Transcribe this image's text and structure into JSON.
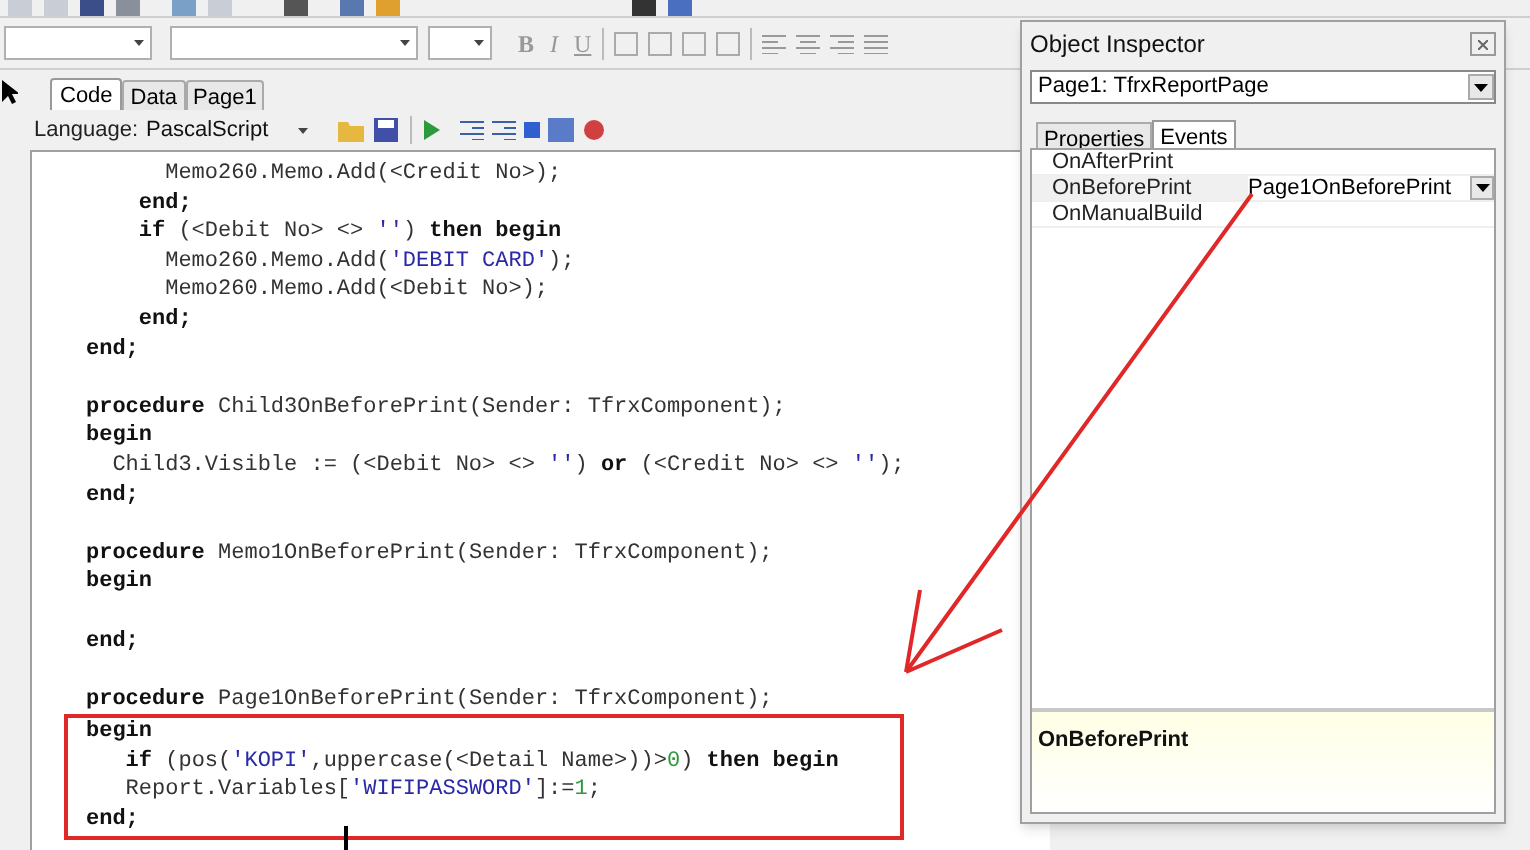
{
  "format_toolbar": {
    "buttons": [
      {
        "label": "B",
        "kind": "bold"
      },
      {
        "label": "I",
        "kind": "italic"
      },
      {
        "label": "U",
        "kind": "underline"
      }
    ]
  },
  "editor_tabs": [
    {
      "label": "Code",
      "selected": true
    },
    {
      "label": "Data",
      "selected": false
    },
    {
      "label": "Page1",
      "selected": false
    }
  ],
  "language": {
    "label": "Language:",
    "value": "PascalScript"
  },
  "code_lines": [
    {
      "kind": "code",
      "tokens": [
        {
          "kind": "plain",
          "text": "      Memo260.Memo.Add(<Credit No>);"
        }
      ]
    },
    {
      "kind": "code",
      "tokens": [
        {
          "kind": "keyword",
          "text": "    end;"
        }
      ]
    },
    {
      "kind": "code",
      "tokens": [
        {
          "kind": "keyword",
          "text": "    if"
        },
        {
          "kind": "plain",
          "text": " (<Debit No> <> "
        },
        {
          "kind": "string",
          "text": "''"
        },
        {
          "kind": "plain",
          "text": ") "
        },
        {
          "kind": "keyword",
          "text": "then begin"
        }
      ]
    },
    {
      "kind": "code",
      "tokens": [
        {
          "kind": "plain",
          "text": "      Memo260.Memo.Add("
        },
        {
          "kind": "string",
          "text": "'DEBIT CARD'"
        },
        {
          "kind": "plain",
          "text": ");"
        }
      ]
    },
    {
      "kind": "code",
      "tokens": [
        {
          "kind": "plain",
          "text": "      Memo260.Memo.Add(<Debit No>);"
        }
      ]
    },
    {
      "kind": "code",
      "tokens": [
        {
          "kind": "keyword",
          "text": "    end;"
        }
      ]
    },
    {
      "kind": "code",
      "tokens": [
        {
          "kind": "keyword",
          "text": "end;"
        }
      ]
    },
    {
      "kind": "blank"
    },
    {
      "kind": "code",
      "tokens": [
        {
          "kind": "keyword",
          "text": "procedure"
        },
        {
          "kind": "plain",
          "text": " Child3OnBeforePrint(Sender: TfrxComponent);"
        }
      ]
    },
    {
      "kind": "code",
      "tokens": [
        {
          "kind": "keyword",
          "text": "begin"
        }
      ]
    },
    {
      "kind": "code",
      "tokens": [
        {
          "kind": "plain",
          "text": "  Child3.Visible := (<Debit No> <> "
        },
        {
          "kind": "string",
          "text": "''"
        },
        {
          "kind": "plain",
          "text": ") "
        },
        {
          "kind": "keyword",
          "text": "or"
        },
        {
          "kind": "plain",
          "text": " (<Credit No> <> "
        },
        {
          "kind": "string",
          "text": "''"
        },
        {
          "kind": "plain",
          "text": ");"
        }
      ]
    },
    {
      "kind": "code",
      "tokens": [
        {
          "kind": "keyword",
          "text": "end;"
        }
      ]
    },
    {
      "kind": "blank"
    },
    {
      "kind": "code",
      "tokens": [
        {
          "kind": "keyword",
          "text": "procedure"
        },
        {
          "kind": "plain",
          "text": " Memo1OnBeforePrint(Sender: TfrxComponent);"
        }
      ]
    },
    {
      "kind": "code",
      "tokens": [
        {
          "kind": "keyword",
          "text": "begin"
        }
      ]
    },
    {
      "kind": "blank"
    },
    {
      "kind": "code",
      "tokens": [
        {
          "kind": "keyword",
          "text": "end;"
        }
      ]
    },
    {
      "kind": "blank"
    },
    {
      "kind": "code",
      "tokens": [
        {
          "kind": "keyword",
          "text": "procedure"
        },
        {
          "kind": "plain",
          "text": " Page1OnBeforePrint(Sender: TfrxComponent);"
        }
      ]
    },
    {
      "kind": "code",
      "highlighted": true,
      "tokens": [
        {
          "kind": "keyword",
          "text": "begin"
        }
      ]
    },
    {
      "kind": "code",
      "highlighted": true,
      "tokens": [
        {
          "kind": "keyword",
          "text": "   if"
        },
        {
          "kind": "plain",
          "text": " (pos("
        },
        {
          "kind": "string",
          "text": "'KOPI'"
        },
        {
          "kind": "plain",
          "text": ",uppercase(<Detail Name>))>"
        },
        {
          "kind": "number",
          "text": "0"
        },
        {
          "kind": "plain",
          "text": ") "
        },
        {
          "kind": "keyword",
          "text": "then begin"
        }
      ]
    },
    {
      "kind": "code",
      "highlighted": true,
      "tokens": [
        {
          "kind": "plain",
          "text": "   Report.Variables["
        },
        {
          "kind": "string",
          "text": "'WIFIPASSWORD'"
        },
        {
          "kind": "plain",
          "text": "]:="
        },
        {
          "kind": "number",
          "text": "1"
        },
        {
          "kind": "plain",
          "text": ";"
        }
      ]
    },
    {
      "kind": "code",
      "highlighted": true,
      "tokens": [
        {
          "kind": "keyword",
          "text": "end;"
        }
      ]
    }
  ],
  "object_inspector": {
    "title": "Object Inspector",
    "object": "Page1: TfrxReportPage",
    "tabs": [
      {
        "label": "Properties",
        "selected": false
      },
      {
        "label": "Events",
        "selected": true
      }
    ],
    "events": [
      {
        "name": "OnAfterPrint",
        "selected": false
      },
      {
        "name": "OnBeforePrint",
        "value": "Page1OnBeforePrint",
        "selected": true
      },
      {
        "name": "OnManualBuild",
        "selected": false
      }
    ],
    "description": "OnBeforePrint"
  }
}
